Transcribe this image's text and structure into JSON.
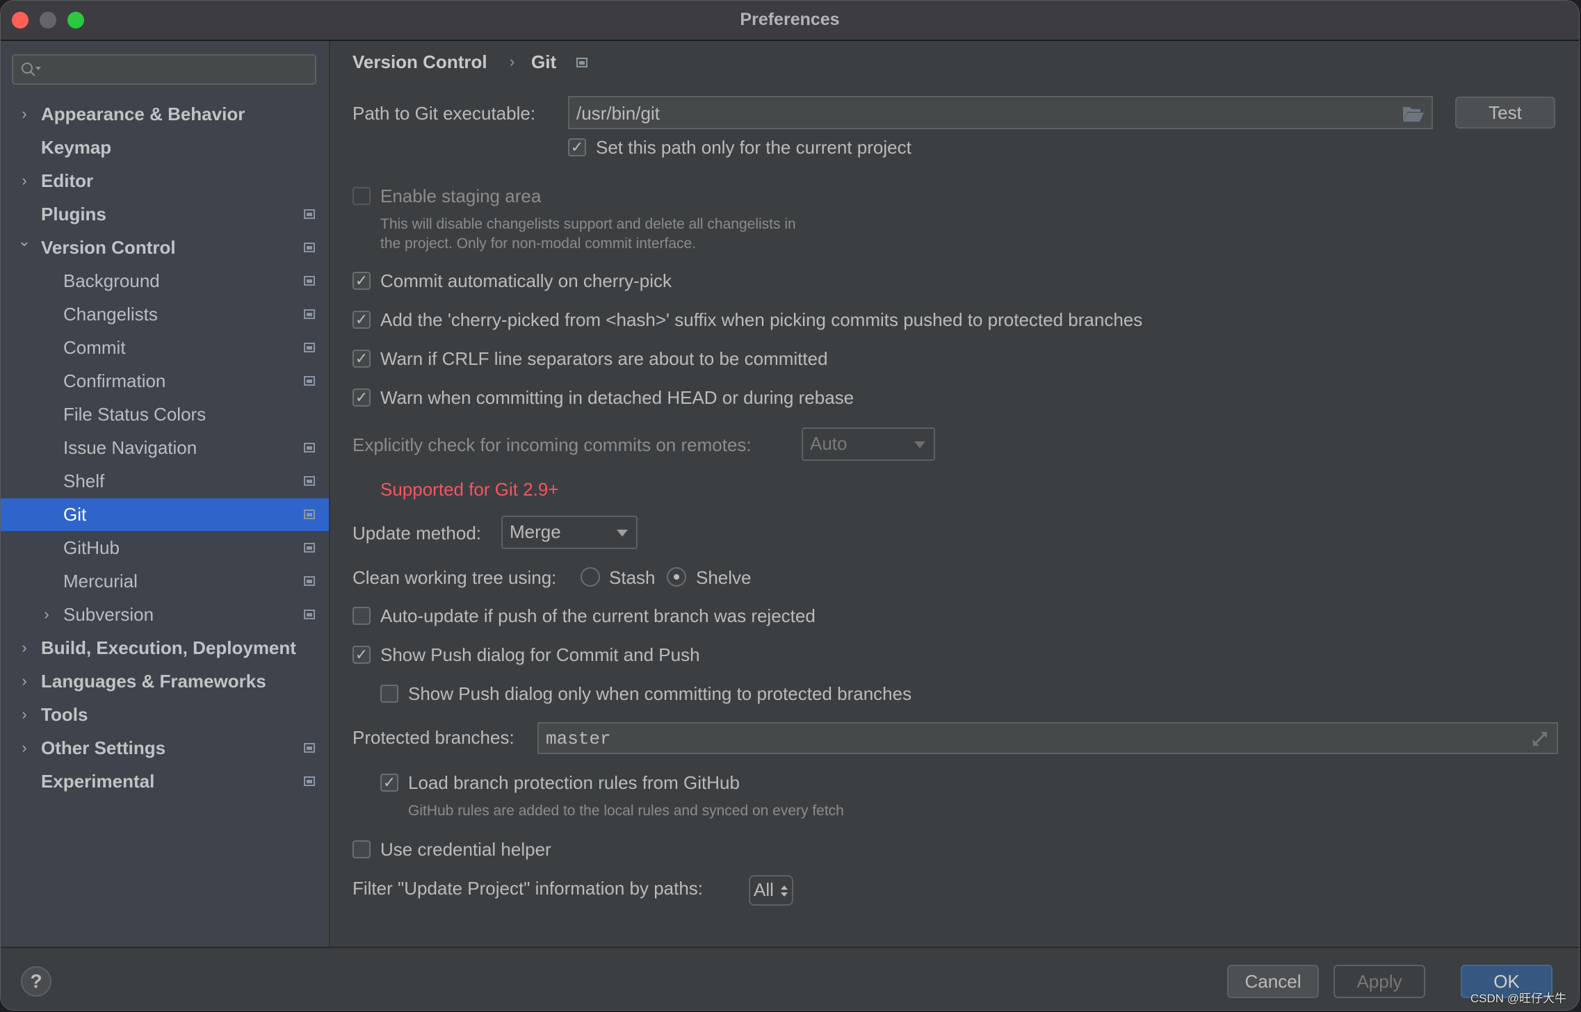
{
  "window": {
    "title": "Preferences"
  },
  "sidebar": {
    "search_placeholder": "",
    "items": [
      {
        "label": "Appearance & Behavior",
        "level": 0,
        "expandable": true,
        "expanded": false,
        "project_icon": false,
        "selected": false
      },
      {
        "label": "Keymap",
        "level": 0,
        "expandable": false,
        "project_icon": false,
        "selected": false
      },
      {
        "label": "Editor",
        "level": 0,
        "expandable": true,
        "expanded": false,
        "project_icon": false,
        "selected": false
      },
      {
        "label": "Plugins",
        "level": 0,
        "expandable": false,
        "project_icon": true,
        "selected": false
      },
      {
        "label": "Version Control",
        "level": 0,
        "expandable": true,
        "expanded": true,
        "project_icon": true,
        "selected": false
      },
      {
        "label": "Background",
        "level": 1,
        "expandable": false,
        "project_icon": true,
        "selected": false
      },
      {
        "label": "Changelists",
        "level": 1,
        "expandable": false,
        "project_icon": true,
        "selected": false
      },
      {
        "label": "Commit",
        "level": 1,
        "expandable": false,
        "project_icon": true,
        "selected": false
      },
      {
        "label": "Confirmation",
        "level": 1,
        "expandable": false,
        "project_icon": true,
        "selected": false
      },
      {
        "label": "File Status Colors",
        "level": 1,
        "expandable": false,
        "project_icon": false,
        "selected": false
      },
      {
        "label": "Issue Navigation",
        "level": 1,
        "expandable": false,
        "project_icon": true,
        "selected": false
      },
      {
        "label": "Shelf",
        "level": 1,
        "expandable": false,
        "project_icon": true,
        "selected": false
      },
      {
        "label": "Git",
        "level": 1,
        "expandable": false,
        "project_icon": true,
        "selected": true
      },
      {
        "label": "GitHub",
        "level": 1,
        "expandable": false,
        "project_icon": true,
        "selected": false
      },
      {
        "label": "Mercurial",
        "level": 1,
        "expandable": false,
        "project_icon": true,
        "selected": false
      },
      {
        "label": "Subversion",
        "level": 1,
        "expandable": true,
        "expanded": false,
        "project_icon": true,
        "selected": false
      },
      {
        "label": "Build, Execution, Deployment",
        "level": 0,
        "expandable": true,
        "expanded": false,
        "project_icon": false,
        "selected": false
      },
      {
        "label": "Languages & Frameworks",
        "level": 0,
        "expandable": true,
        "expanded": false,
        "project_icon": false,
        "selected": false
      },
      {
        "label": "Tools",
        "level": 0,
        "expandable": true,
        "expanded": false,
        "project_icon": false,
        "selected": false
      },
      {
        "label": "Other Settings",
        "level": 0,
        "expandable": true,
        "expanded": false,
        "project_icon": true,
        "selected": false
      },
      {
        "label": "Experimental",
        "level": 0,
        "expandable": false,
        "project_icon": true,
        "selected": false
      }
    ]
  },
  "breadcrumb": {
    "parent": "Version Control",
    "separator": "›",
    "current": "Git"
  },
  "git": {
    "path_label": "Path to Git executable:",
    "path_value": "/usr/bin/git",
    "test_button": "Test",
    "set_path_project": {
      "label": "Set this path only for the current project",
      "checked": true
    },
    "staging": {
      "label": "Enable staging area",
      "checked": false,
      "enabled": false,
      "hint_line1": "This will disable changelists support and delete all changelists in",
      "hint_line2": "the project. Only for non-modal commit interface."
    },
    "options": [
      {
        "label": "Commit automatically on cherry-pick",
        "checked": true
      },
      {
        "label": "Add the 'cherry-picked from <hash>' suffix when picking commits pushed to protected branches",
        "checked": true
      },
      {
        "label": "Warn if CRLF line separators are about to be committed",
        "checked": true
      },
      {
        "label": "Warn when committing in detached HEAD or during rebase",
        "checked": true
      }
    ],
    "incoming_label": "Explicitly check for incoming commits on remotes:",
    "incoming_value": "Auto",
    "supported_note": "Supported for Git 2.9+",
    "update_method_label": "Update method:",
    "update_method_value": "Merge",
    "clean_tree_label": "Clean working tree using:",
    "clean_options": [
      {
        "label": "Stash",
        "selected": false
      },
      {
        "label": "Shelve",
        "selected": true
      }
    ],
    "auto_update": {
      "label": "Auto-update if push of the current branch was rejected",
      "checked": false
    },
    "show_push": {
      "label": "Show Push dialog for Commit and Push",
      "checked": true
    },
    "show_push_protected": {
      "label": "Show Push dialog only when committing to protected branches",
      "checked": false
    },
    "protected_label": "Protected branches:",
    "protected_value": "master",
    "load_rules": {
      "label": "Load branch protection rules from GitHub",
      "checked": true
    },
    "load_rules_hint": "GitHub rules are added to the local rules and synced on every fetch",
    "credential_helper": {
      "label": "Use credential helper",
      "checked": false
    },
    "filter_label": "Filter \"Update Project\" information by paths:",
    "filter_value": "All"
  },
  "footer": {
    "help": "?",
    "cancel": "Cancel",
    "apply": "Apply",
    "ok": "OK"
  },
  "watermark": "CSDN @旺仔大牛",
  "colors": {
    "selection": "#2f65ca",
    "accent_ok": "#365880",
    "error": "#f75464"
  }
}
